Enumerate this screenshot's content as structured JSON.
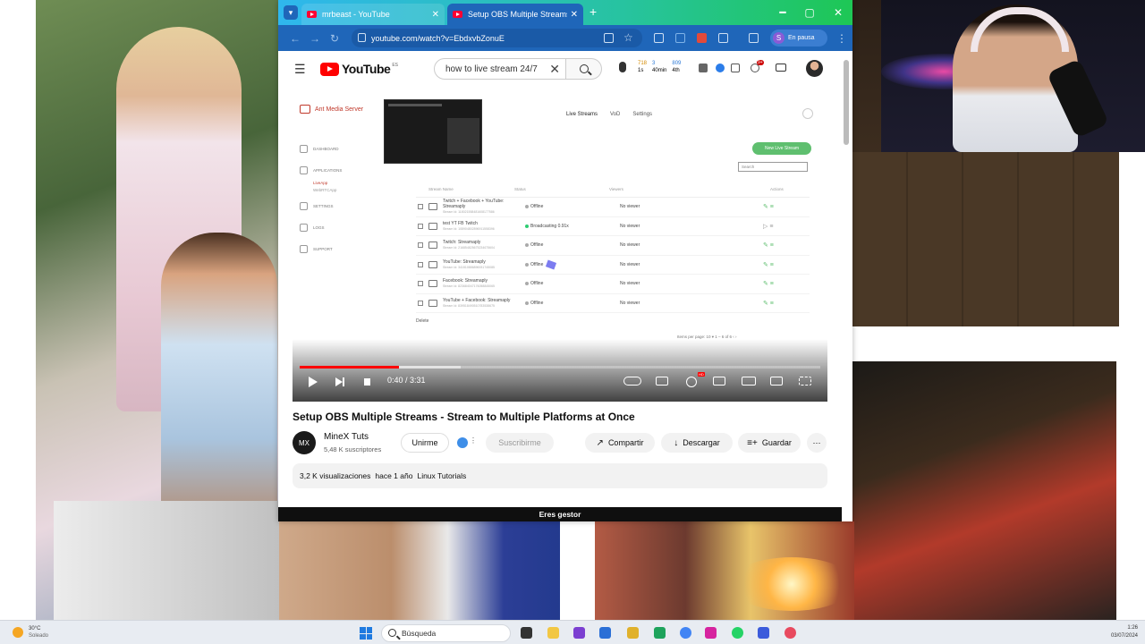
{
  "browser": {
    "tabs": [
      {
        "label": "mrbeast - YouTube",
        "active": false
      },
      {
        "label": "Setup OBS Multiple Streams - S",
        "active": true
      }
    ],
    "url": "youtube.com/watch?v=EbdxvbZonuE",
    "profile_label": "En pausa",
    "profile_initial": "S"
  },
  "youtube": {
    "logo_text": "YouTube",
    "logo_country": "ES",
    "search_value": "how to live stream 24/7",
    "stats": [
      {
        "top": "718",
        "bottom": "1s"
      },
      {
        "top": "3",
        "bottom": "40min"
      },
      {
        "top": "809",
        "bottom": "4th"
      }
    ],
    "notification_badge": "9+"
  },
  "video_frame": {
    "app_name": "Ant Media Server",
    "header_tabs": [
      "Live Streams",
      "VoD",
      "Settings"
    ],
    "sidebar": [
      {
        "label": "DASHBOARD",
        "sub": []
      },
      {
        "label": "APPLICATIONS",
        "sub": [
          "LiveApp",
          "WebRTCApp"
        ]
      },
      {
        "label": "SETTINGS",
        "sub": []
      },
      {
        "label": "LOGS",
        "sub": []
      },
      {
        "label": "SUPPORT",
        "sub": []
      }
    ],
    "new_stream_button": "New Live Stream",
    "search_placeholder": "Search",
    "table_headers": [
      "Stream Name",
      "Status",
      "Viewers",
      "Actions"
    ],
    "rows": [
      {
        "name": "Twitch + Facebook + YouTube: Streamaply",
        "id": "Stream Id: 118021558481608177586",
        "status": "Offline",
        "live": false,
        "viewers": "No viewer"
      },
      {
        "name": "test YT FB Twitch",
        "id": "Stream Id: 108904802896911558396",
        "status": "Broadcasting 0.91x",
        "live": true,
        "viewers": "No viewer"
      },
      {
        "name": "Twitch: Streamaply",
        "id": "Stream Id: 216854825675234675604",
        "status": "Offline",
        "live": false,
        "viewers": "No viewer"
      },
      {
        "name": "YouTube: Streamaply",
        "id": "Stream Id: 341510886896931745085",
        "status": "Offline",
        "live": false,
        "viewers": "No viewer"
      },
      {
        "name": "Facebook: Streamaply",
        "id": "Stream Id: 823684047176058845065",
        "status": "Offline",
        "live": false,
        "viewers": "No viewer"
      },
      {
        "name": "YouTube + Facebook: Streamaply",
        "id": "Stream Id: 839518490510783538675",
        "status": "Offline",
        "live": false,
        "viewers": "No viewer"
      }
    ],
    "delete_label": "Delete",
    "pager": "Items per page: 10  ▾    1 – 6 of 6      ‹   ›"
  },
  "player": {
    "time": "0:40 / 3:31",
    "progress_fraction": 0.19,
    "buffered_fraction": 0.31,
    "hd_badge": "HD"
  },
  "video": {
    "title": "Setup OBS Multiple Streams - Stream to Multiple Platforms at Once",
    "channel_name": "MineX Tuts",
    "channel_initials": "MX",
    "subscribers": "5,48 K suscriptores",
    "join_label": "Unirme",
    "subscribe_label": "Suscribirme",
    "share_label": "Compartir",
    "download_label": "Descargar",
    "save_label": "Guardar",
    "views": "3,2 K visualizaciones",
    "age": "hace 1 año",
    "category": "Linux Tutorials",
    "manager_bar": "Eres gestor"
  },
  "taskbar": {
    "weather_temp": "30°C",
    "weather_desc": "Soleado",
    "search_placeholder": "Búsqueda",
    "time": "1:26",
    "date": "03/07/2024"
  }
}
